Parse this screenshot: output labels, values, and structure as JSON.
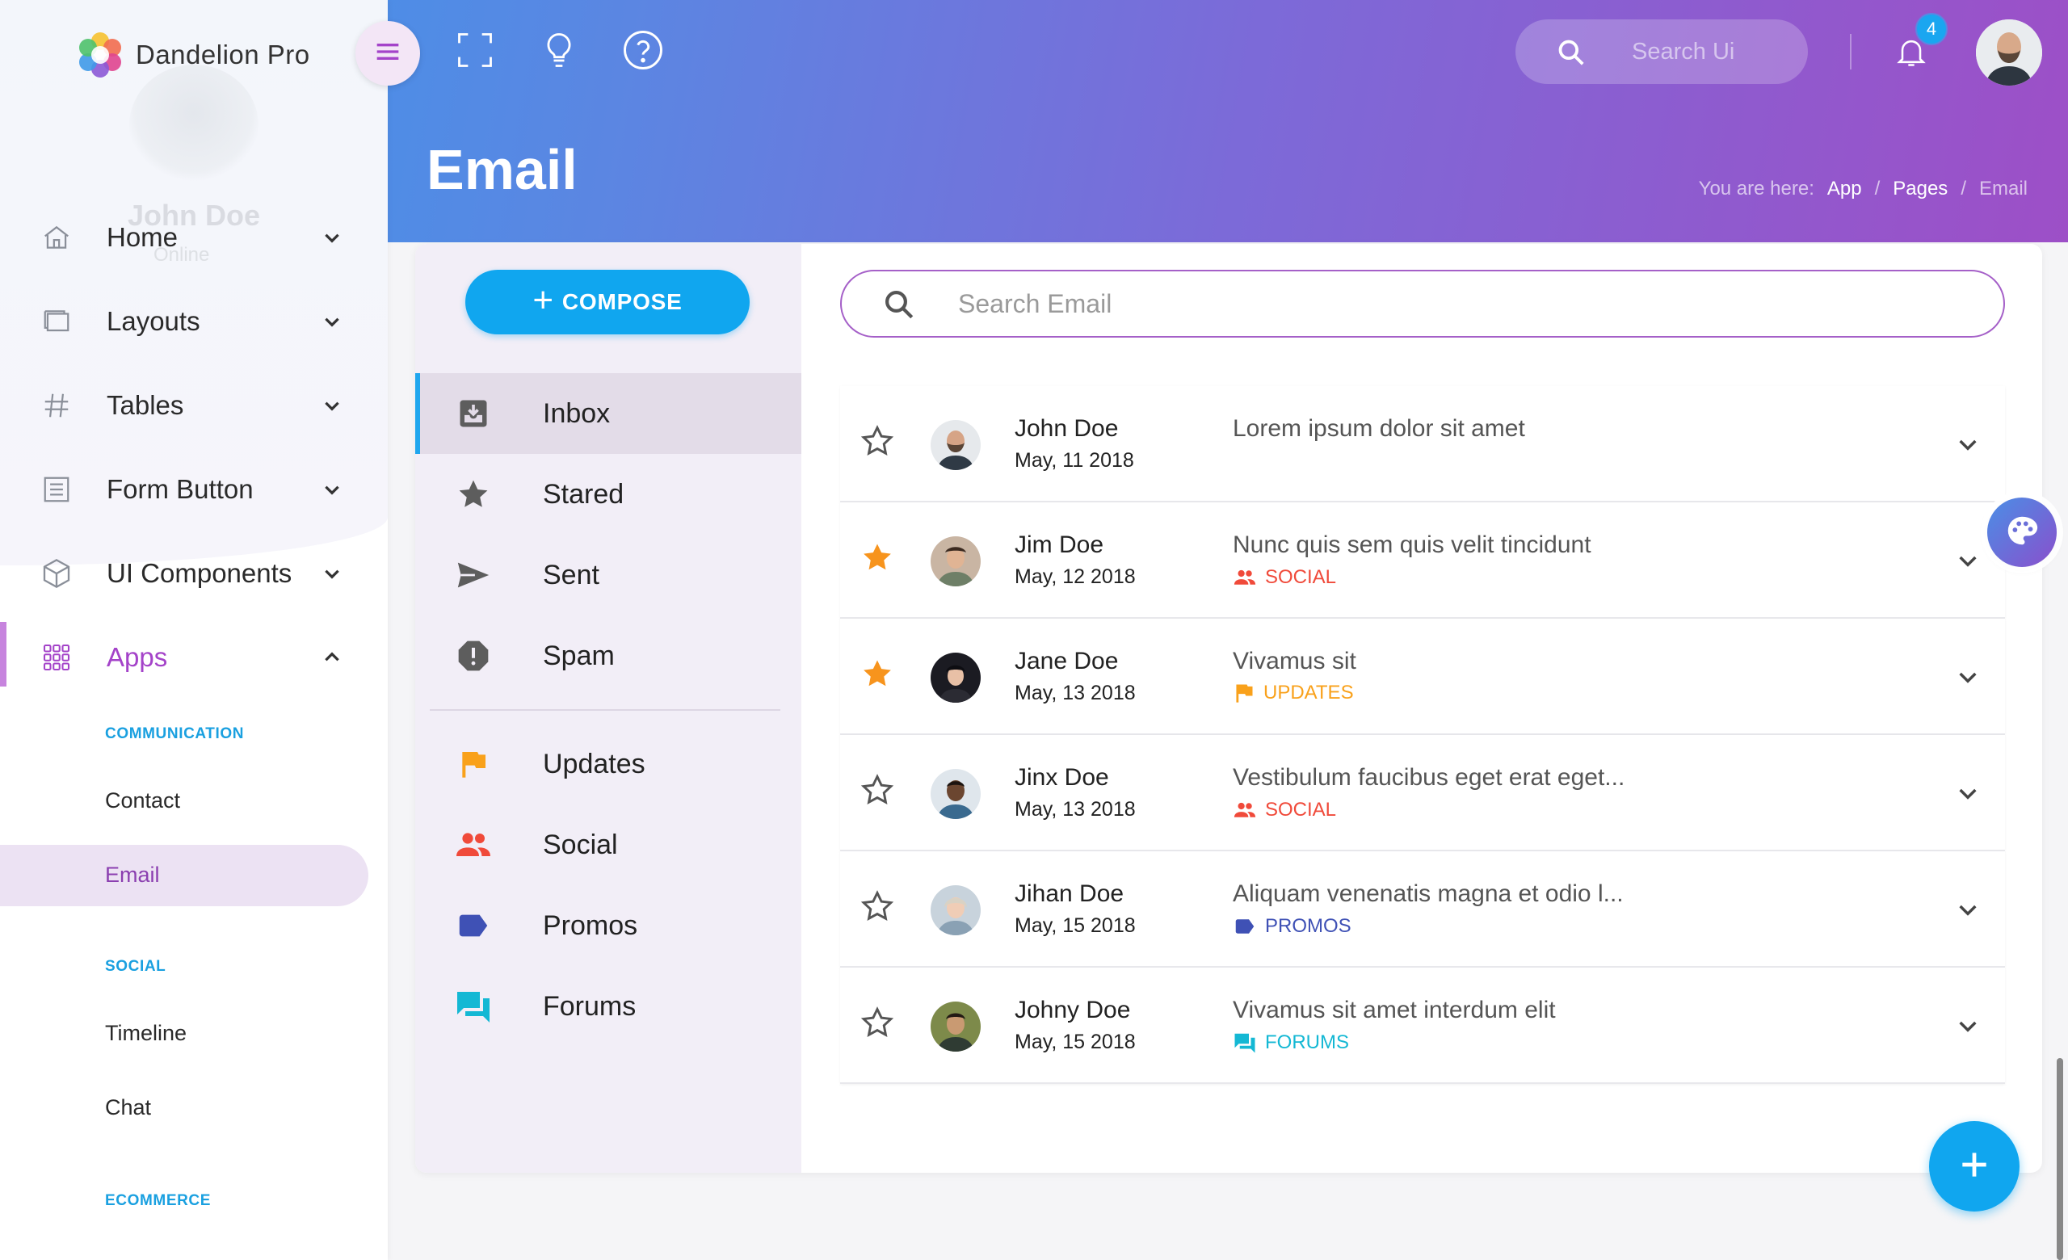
{
  "app": {
    "name": "Dandelion Pro"
  },
  "profile": {
    "name": "John Doe",
    "status": "Online"
  },
  "header": {
    "search_placeholder": "Search Ui",
    "notification_count": "4"
  },
  "page": {
    "title": "Email",
    "breadcrumb": {
      "prefix": "You are here:",
      "items": [
        "App",
        "Pages",
        "Email"
      ],
      "separator": "/"
    }
  },
  "sidebar": {
    "items": [
      {
        "label": "Home",
        "icon": "home-icon"
      },
      {
        "label": "Layouts",
        "icon": "layouts-icon"
      },
      {
        "label": "Tables",
        "icon": "hash-icon"
      },
      {
        "label": "Form Button",
        "icon": "list-icon"
      },
      {
        "label": "UI Components",
        "icon": "cube-icon"
      },
      {
        "label": "Apps",
        "icon": "apps-grid-icon",
        "active": true
      }
    ],
    "groups": [
      {
        "heading": "COMMUNICATION",
        "items": [
          "Contact",
          "Email"
        ]
      },
      {
        "heading": "SOCIAL",
        "items": [
          "Timeline",
          "Chat"
        ]
      },
      {
        "heading": "ECOMMERCE",
        "items": []
      }
    ],
    "active_sub_item": "Email"
  },
  "mail": {
    "compose_label": "COMPOSE",
    "search_placeholder": "Search Email",
    "folders": [
      {
        "label": "Inbox",
        "icon": "inbox-icon",
        "active": true
      },
      {
        "label": "Stared",
        "icon": "star-icon"
      },
      {
        "label": "Sent",
        "icon": "send-icon"
      },
      {
        "label": "Spam",
        "icon": "spam-icon"
      }
    ],
    "labels": [
      {
        "label": "Updates",
        "icon": "flag-icon",
        "color": "#f9a11b"
      },
      {
        "label": "Social",
        "icon": "people-icon",
        "color": "#f04a3a"
      },
      {
        "label": "Promos",
        "icon": "tag-icon",
        "color": "#3f51b5"
      },
      {
        "label": "Forums",
        "icon": "forum-icon",
        "color": "#14b8d4"
      }
    ],
    "messages": [
      {
        "sender": "John Doe",
        "date": "May, 11 2018",
        "subject": "Lorem ipsum dolor sit amet",
        "starred": false,
        "tag": "",
        "tag_color": ""
      },
      {
        "sender": "Jim Doe",
        "date": "May, 12 2018",
        "subject": "Nunc quis sem quis velit tincidunt",
        "starred": true,
        "tag": "SOCIAL",
        "tag_color": "#f04a3a"
      },
      {
        "sender": "Jane Doe",
        "date": "May, 13 2018",
        "subject": "Vivamus sit",
        "starred": true,
        "tag": "UPDATES",
        "tag_color": "#f9a11b"
      },
      {
        "sender": "Jinx Doe",
        "date": "May, 13 2018",
        "subject": "Vestibulum faucibus eget erat eget...",
        "starred": false,
        "tag": "SOCIAL",
        "tag_color": "#f04a3a"
      },
      {
        "sender": "Jihan Doe",
        "date": "May, 15 2018",
        "subject": "Aliquam venenatis magna et odio l...",
        "starred": false,
        "tag": "PROMOS",
        "tag_color": "#3f51b5"
      },
      {
        "sender": "Johny Doe",
        "date": "May, 15 2018",
        "subject": "Vivamus sit amet interdum elit",
        "starred": false,
        "tag": "FORUMS",
        "tag_color": "#14b8d4"
      }
    ]
  },
  "colors": {
    "accent_blue": "#10a6ef",
    "accent_purple": "#a443c9",
    "star_orange": "#f7941d"
  }
}
